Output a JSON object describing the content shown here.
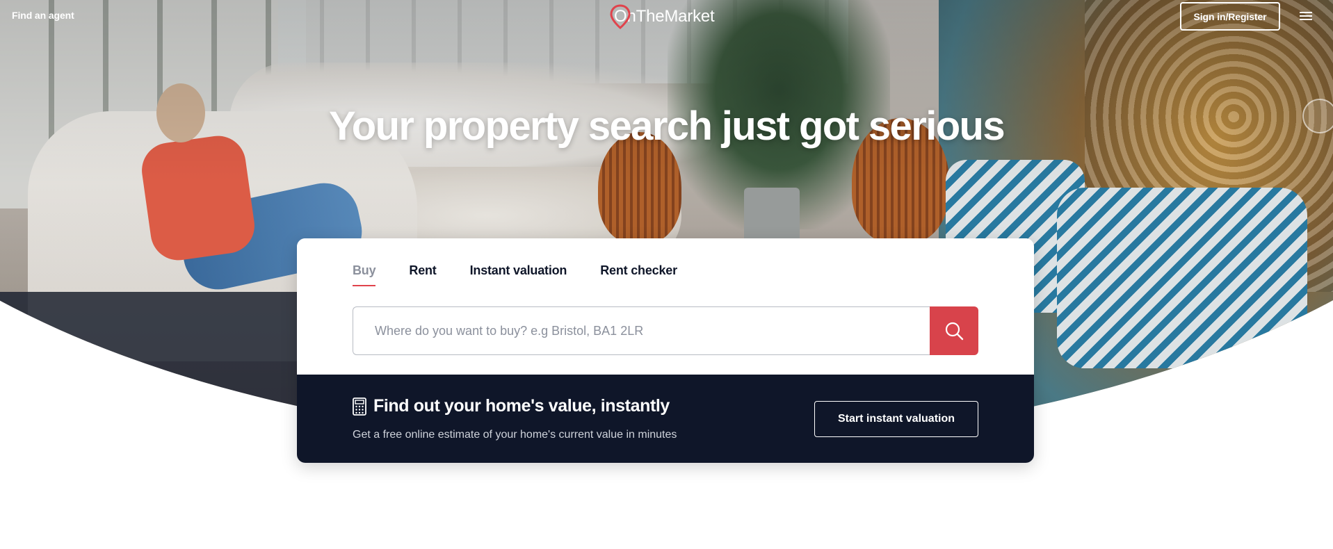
{
  "header": {
    "find_agent": "Find an agent",
    "logo": "OnTheMarket",
    "sign_in": "Sign in/Register",
    "menu_icon": "hamburger-menu-icon"
  },
  "hero": {
    "headline": "Your property search just got serious"
  },
  "search": {
    "tabs": [
      {
        "label": "Buy",
        "active": true
      },
      {
        "label": "Rent",
        "active": false
      },
      {
        "label": "Instant valuation",
        "active": false
      },
      {
        "label": "Rent checker",
        "active": false
      }
    ],
    "placeholder": "Where do you want to buy? e.g Bristol, BA1 2LR",
    "button_icon": "search-icon"
  },
  "valuation": {
    "icon": "calculator-icon",
    "title": "Find out your home's value, instantly",
    "subtitle": "Get a free online estimate of your home's current value in minutes",
    "button": "Start instant valuation"
  },
  "colors": {
    "brand_red": "#d8434b",
    "navy": "#0f1629",
    "muted_text": "#8b909c"
  }
}
